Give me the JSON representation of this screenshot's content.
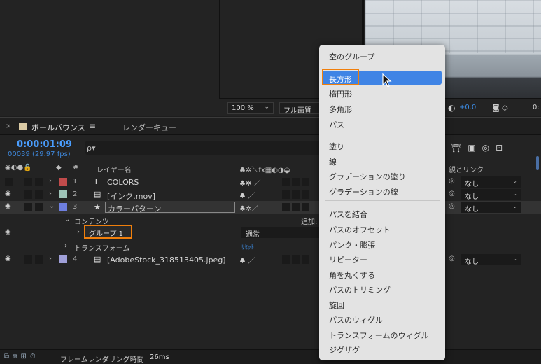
{
  "viewer": {
    "zoom": "100 %",
    "quality": "フル画質",
    "exposure": "+0.0",
    "value": "0:"
  },
  "tabs": {
    "composition": "ボールバウンス",
    "render_queue": "レンダーキュー"
  },
  "timeline": {
    "timecode": "0:00:01:09",
    "frames": "00039 (29.97 fps)",
    "search_placeholder": "ρ▾"
  },
  "columns": {
    "layer_name": "レイヤー名",
    "parent_link": "親とリンク"
  },
  "layers": [
    {
      "num": "1",
      "type": "T",
      "name": "COLORS",
      "color": "#c14b4b",
      "parent": "なし"
    },
    {
      "num": "2",
      "type": "▤",
      "name": "[インク.mov]",
      "color": "#9ec4b8",
      "parent": "なし"
    },
    {
      "num": "3",
      "type": "★",
      "name": "カラーパターン",
      "color": "#6e7fe0",
      "parent": "なし"
    },
    {
      "num": "4",
      "type": "▤",
      "name": "[AdobeStock_318513405.jpeg]",
      "color": "#9f9fd8",
      "parent": "なし"
    }
  ],
  "sublayers": {
    "contents": "コンテンツ",
    "add": "追加:",
    "group": "グループ 1",
    "blend_mode": "通常",
    "transform": "トランスフォーム",
    "reset": "ﾘｾｯﾄ"
  },
  "bottom": {
    "render_label": "フレームレンダリング時間",
    "render_time": "26ms"
  },
  "menu": {
    "items": [
      "空のグループ",
      "長方形",
      "楕円形",
      "多角形",
      "パス",
      "塗り",
      "線",
      "グラデーションの塗り",
      "グラデーションの線",
      "パスを結合",
      "パスのオフセット",
      "パンク・膨張",
      "リピーター",
      "角を丸くする",
      "パスのトリミング",
      "旋回",
      "パスのウィグル",
      "トランスフォームのウィグル",
      "ジグザグ"
    ],
    "highlighted_color": "#3f84e5",
    "callout_color": "#f07f0c"
  }
}
